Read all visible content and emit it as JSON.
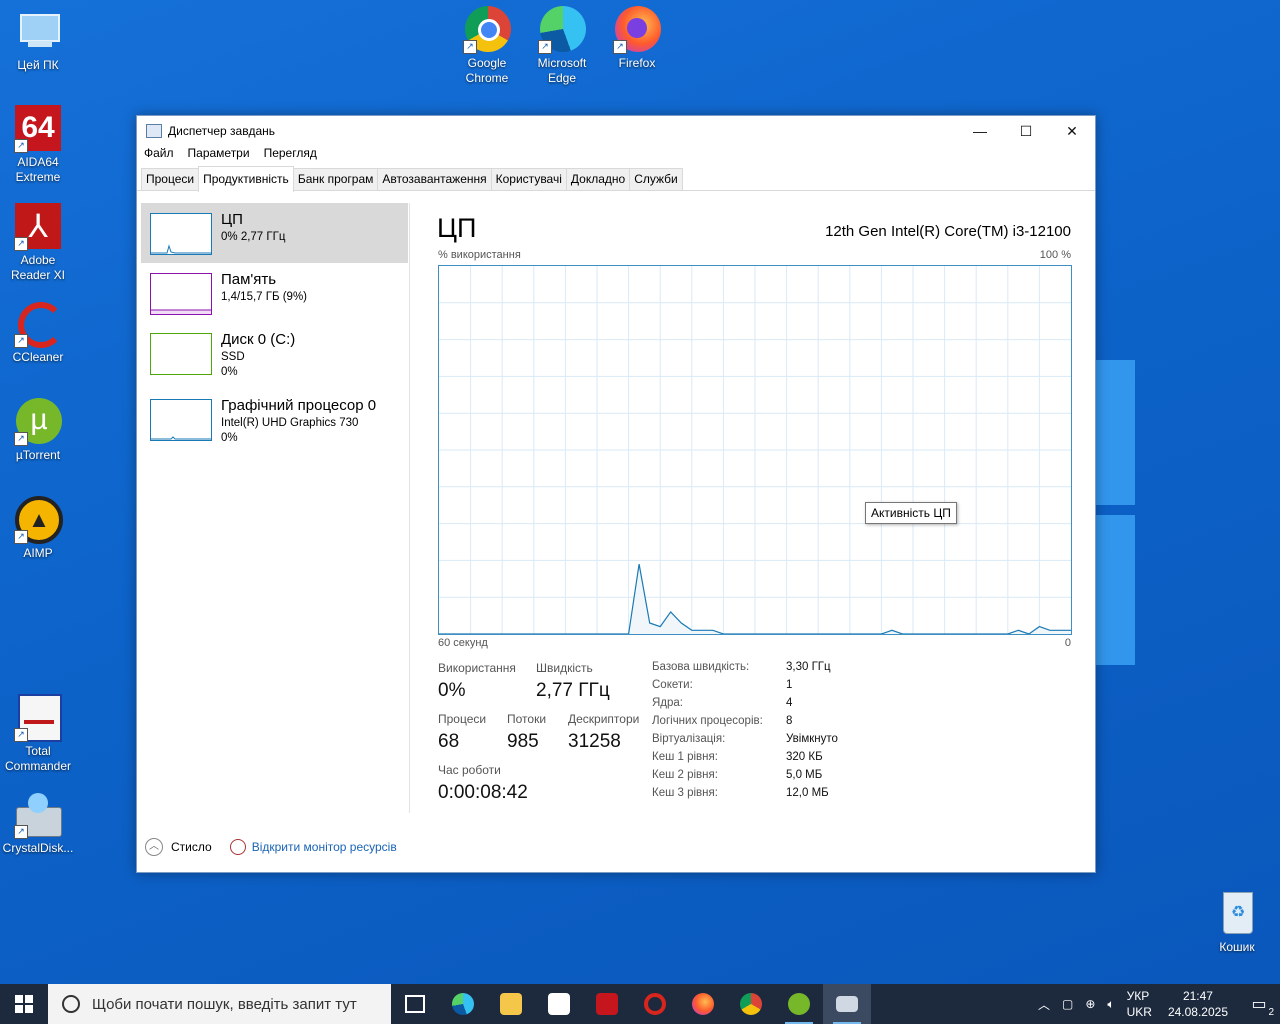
{
  "desktop": {
    "icons": [
      {
        "label": "Цей ПК",
        "icon": "computer-icon"
      },
      {
        "label": "AIDA64\nExtreme",
        "icon": "aida64-icon"
      },
      {
        "label": "Adobe\nReader XI",
        "icon": "adobe-reader-icon"
      },
      {
        "label": "CCleaner",
        "icon": "ccleaner-icon"
      },
      {
        "label": "µTorrent",
        "icon": "utorrent-icon"
      },
      {
        "label": "AIMP",
        "icon": "aimp-icon"
      },
      {
        "label": "Total\nCommander",
        "icon": "total-commander-icon"
      },
      {
        "label": "CrystalDisk...",
        "icon": "crystaldisk-icon"
      },
      {
        "label": "Google\nChrome",
        "icon": "chrome-icon"
      },
      {
        "label": "Microsoft\nEdge",
        "icon": "edge-icon"
      },
      {
        "label": "Firefox",
        "icon": "firefox-icon"
      },
      {
        "label": "Кошик",
        "icon": "recycle-bin-icon"
      }
    ]
  },
  "window": {
    "title": "Диспетчер завдань",
    "menu": [
      "Файл",
      "Параметри",
      "Перегляд"
    ],
    "tabs": [
      "Процеси",
      "Продуктивність",
      "Банк програм",
      "Автозавантаження",
      "Користувачі",
      "Докладно",
      "Служби"
    ],
    "active_tab": "Продуктивність"
  },
  "resources": [
    {
      "name": "ЦП",
      "line1": "0% 2,77 ГГц",
      "line2": "",
      "color": "#1a7ab5"
    },
    {
      "name": "Пам'ять",
      "line1": "1,4/15,7 ГБ (9%)",
      "line2": "",
      "color": "#8b12ae"
    },
    {
      "name": "Диск 0 (C:)",
      "line1": "SSD",
      "line2": "0%",
      "color": "#4da60c"
    },
    {
      "name": "Графічний процесор 0",
      "line1": "Intel(R) UHD Graphics 730",
      "line2": "0%",
      "color": "#1a7ab5"
    }
  ],
  "cpu": {
    "title": "ЦП",
    "model": "12th Gen Intel(R) Core(TM) i3-12100",
    "graph_label_left": "% використання",
    "graph_label_right": "100 %",
    "graph_bottom_left": "60 секунд",
    "graph_bottom_right": "0",
    "tooltip": "Активність ЦП",
    "stats": {
      "usage_label": "Використання",
      "usage": "0%",
      "speed_label": "Швидкість",
      "speed": "2,77 ГГц",
      "processes_label": "Процеси",
      "processes": "68",
      "threads_label": "Потоки",
      "threads": "985",
      "handles_label": "Дескриптори",
      "handles": "31258",
      "uptime_label": "Час роботи",
      "uptime": "0:00:08:42"
    },
    "info": [
      {
        "label": "Базова швидкість:",
        "value": "3,30 ГГц"
      },
      {
        "label": "Сокети:",
        "value": "1"
      },
      {
        "label": "Ядра:",
        "value": "4"
      },
      {
        "label": "Логічних процесорів:",
        "value": "8"
      },
      {
        "label": "Віртуалізація:",
        "value": "Увімкнуто"
      },
      {
        "label": "Кеш 1 рівня:",
        "value": "320 КБ"
      },
      {
        "label": "Кеш 2 рівня:",
        "value": "5,0 МБ"
      },
      {
        "label": "Кеш 3 рівня:",
        "value": "12,0 МБ"
      }
    ]
  },
  "footer": {
    "collapse": "Стисло",
    "resource_monitor": "Відкрити монітор ресурсів"
  },
  "taskbar": {
    "search_placeholder": "Щоби почати пошук, введіть запит тут",
    "lang_top": "УКР",
    "lang_bottom": "UKR",
    "time": "21:47",
    "date": "24.08.2025",
    "notifications": "2"
  },
  "chart_data": {
    "type": "line",
    "ylim": [
      0,
      100
    ],
    "xlabel": "60 секунд",
    "ylabel": "% використання",
    "series": [
      {
        "values": [
          0,
          0,
          0,
          0,
          0,
          0,
          0,
          0,
          0,
          0,
          0,
          0,
          0,
          0,
          0,
          0,
          0,
          0,
          0,
          19,
          3,
          2,
          6,
          3,
          1,
          1,
          1,
          0,
          0,
          0,
          0,
          0,
          0,
          0,
          0,
          0,
          0,
          0,
          0,
          0,
          0,
          0,
          0,
          1,
          0,
          0,
          0,
          0,
          0,
          0,
          0,
          0,
          0,
          0,
          0,
          1,
          0,
          2,
          1,
          1,
          1
        ]
      }
    ]
  }
}
